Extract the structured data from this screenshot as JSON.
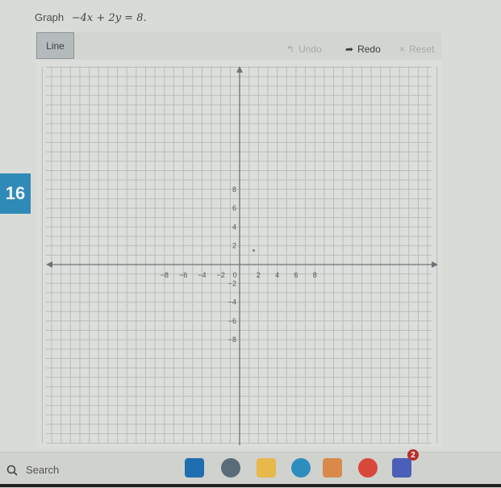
{
  "question": {
    "number": "16",
    "prompt_label": "Graph",
    "equation": "−4x + 2y = 8."
  },
  "toolbar": {
    "tool_label": "Line",
    "undo_label": "Undo",
    "redo_label": "Redo",
    "reset_label": "Reset",
    "undo_enabled": false,
    "redo_enabled": true,
    "reset_enabled": false
  },
  "graph": {
    "x_range": [
      -10,
      10
    ],
    "y_range": [
      -10,
      10
    ],
    "grid_step": 1,
    "x_tick_labels": [
      "-8",
      "-6",
      "-4",
      "-2",
      "0",
      "2",
      "4",
      "6",
      "8"
    ],
    "y_tick_labels": [
      "8",
      "6",
      "4",
      "2",
      "-2",
      "-4",
      "-6",
      "-8"
    ],
    "points": [
      {
        "x": 1.5,
        "y": 1.5
      }
    ],
    "colors": {
      "grid": "#b9bcb8",
      "axis": "#6f7375",
      "background": "#dcdedb"
    }
  },
  "taskbar": {
    "search_label": "Search",
    "apps": [
      {
        "name": "store-icon",
        "color": "#1f6fb0"
      },
      {
        "name": "settings-icon",
        "color": "#5b6c79"
      },
      {
        "name": "file-explorer-icon",
        "color": "#e7b84a"
      },
      {
        "name": "edge-icon",
        "color": "#2e8dbf"
      },
      {
        "name": "media-player-icon",
        "color": "#d98a4a"
      },
      {
        "name": "chrome-icon",
        "color": "#d9473b"
      },
      {
        "name": "teams-icon",
        "color": "#4b5fb8"
      }
    ],
    "teams_badge": "2"
  }
}
